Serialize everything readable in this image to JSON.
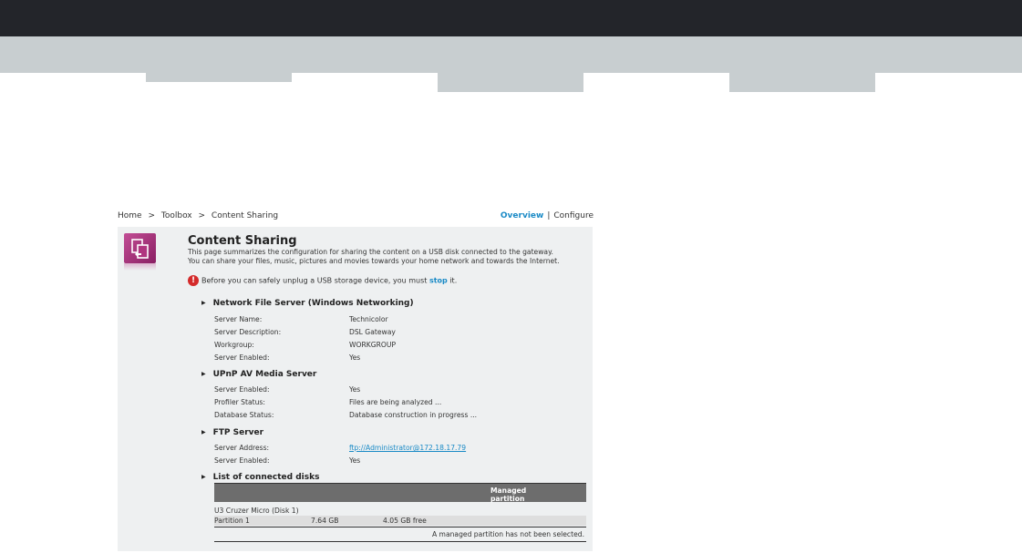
{
  "breadcrumb": {
    "home": "Home",
    "sep": ">",
    "toolbox": "Toolbox",
    "current": "Content Sharing"
  },
  "view": {
    "overview": "Overview",
    "separator": "|",
    "configure": "Configure"
  },
  "page": {
    "title": "Content Sharing",
    "desc1": "This page summarizes the configuration for sharing the content on a USB disk connected to the gateway.",
    "desc2": "You can share your files, music, pictures and movies towards your home network and towards the Internet."
  },
  "warning": {
    "before": "Before you can safely unplug a USB storage device, you must",
    "link": "stop",
    "after": "it."
  },
  "nfs": {
    "title": "Network File Server (Windows Networking)",
    "rows": [
      {
        "k": "Server Name:",
        "v": "Technicolor"
      },
      {
        "k": "Server Description:",
        "v": "DSL Gateway"
      },
      {
        "k": "Workgroup:",
        "v": "WORKGROUP"
      },
      {
        "k": "Server Enabled:",
        "v": "Yes"
      }
    ]
  },
  "upnp": {
    "title": "UPnP AV Media Server",
    "rows": [
      {
        "k": "Server Enabled:",
        "v": "Yes"
      },
      {
        "k": "Profiler Status:",
        "v": "Files are being analyzed ..."
      },
      {
        "k": "Database Status:",
        "v": "Database construction in progress ..."
      }
    ]
  },
  "ftp": {
    "title": "FTP Server",
    "rows": [
      {
        "k": "Server Address:",
        "v": "ftp://Administrator@172.18.17.79"
      },
      {
        "k": "Server Enabled:",
        "v": "Yes"
      }
    ]
  },
  "disks": {
    "title": "List of connected disks",
    "col_managed": "Managed partition",
    "disk_name": "U3 Cruzer Micro (Disk 1)",
    "partition": {
      "name": "Partition 1",
      "size": "7.64 GB",
      "free": "4.05 GB free"
    },
    "note": "A managed partition has not been selected."
  },
  "colors": {
    "accent": "#1a8ac6",
    "topbar": "#23252a",
    "navbar": "#c8ced0",
    "icon": "#b0357f"
  }
}
